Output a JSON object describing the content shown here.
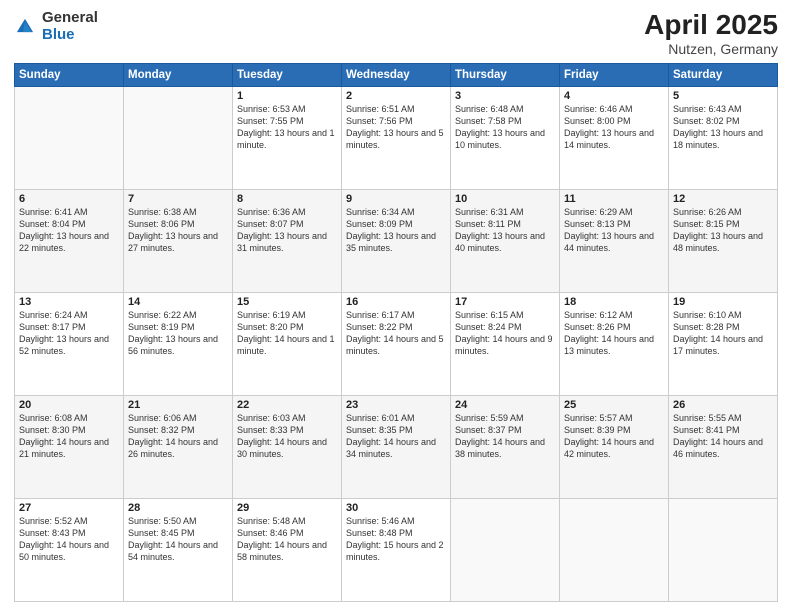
{
  "logo": {
    "general": "General",
    "blue": "Blue"
  },
  "header": {
    "month": "April 2025",
    "location": "Nutzen, Germany"
  },
  "weekdays": [
    "Sunday",
    "Monday",
    "Tuesday",
    "Wednesday",
    "Thursday",
    "Friday",
    "Saturday"
  ],
  "days": [
    {
      "date": "",
      "sunrise": "",
      "sunset": "",
      "daylight": ""
    },
    {
      "date": "",
      "sunrise": "",
      "sunset": "",
      "daylight": ""
    },
    {
      "date": "1",
      "sunrise": "Sunrise: 6:53 AM",
      "sunset": "Sunset: 7:55 PM",
      "daylight": "Daylight: 13 hours and 1 minute."
    },
    {
      "date": "2",
      "sunrise": "Sunrise: 6:51 AM",
      "sunset": "Sunset: 7:56 PM",
      "daylight": "Daylight: 13 hours and 5 minutes."
    },
    {
      "date": "3",
      "sunrise": "Sunrise: 6:48 AM",
      "sunset": "Sunset: 7:58 PM",
      "daylight": "Daylight: 13 hours and 10 minutes."
    },
    {
      "date": "4",
      "sunrise": "Sunrise: 6:46 AM",
      "sunset": "Sunset: 8:00 PM",
      "daylight": "Daylight: 13 hours and 14 minutes."
    },
    {
      "date": "5",
      "sunrise": "Sunrise: 6:43 AM",
      "sunset": "Sunset: 8:02 PM",
      "daylight": "Daylight: 13 hours and 18 minutes."
    },
    {
      "date": "6",
      "sunrise": "Sunrise: 6:41 AM",
      "sunset": "Sunset: 8:04 PM",
      "daylight": "Daylight: 13 hours and 22 minutes."
    },
    {
      "date": "7",
      "sunrise": "Sunrise: 6:38 AM",
      "sunset": "Sunset: 8:06 PM",
      "daylight": "Daylight: 13 hours and 27 minutes."
    },
    {
      "date": "8",
      "sunrise": "Sunrise: 6:36 AM",
      "sunset": "Sunset: 8:07 PM",
      "daylight": "Daylight: 13 hours and 31 minutes."
    },
    {
      "date": "9",
      "sunrise": "Sunrise: 6:34 AM",
      "sunset": "Sunset: 8:09 PM",
      "daylight": "Daylight: 13 hours and 35 minutes."
    },
    {
      "date": "10",
      "sunrise": "Sunrise: 6:31 AM",
      "sunset": "Sunset: 8:11 PM",
      "daylight": "Daylight: 13 hours and 40 minutes."
    },
    {
      "date": "11",
      "sunrise": "Sunrise: 6:29 AM",
      "sunset": "Sunset: 8:13 PM",
      "daylight": "Daylight: 13 hours and 44 minutes."
    },
    {
      "date": "12",
      "sunrise": "Sunrise: 6:26 AM",
      "sunset": "Sunset: 8:15 PM",
      "daylight": "Daylight: 13 hours and 48 minutes."
    },
    {
      "date": "13",
      "sunrise": "Sunrise: 6:24 AM",
      "sunset": "Sunset: 8:17 PM",
      "daylight": "Daylight: 13 hours and 52 minutes."
    },
    {
      "date": "14",
      "sunrise": "Sunrise: 6:22 AM",
      "sunset": "Sunset: 8:19 PM",
      "daylight": "Daylight: 13 hours and 56 minutes."
    },
    {
      "date": "15",
      "sunrise": "Sunrise: 6:19 AM",
      "sunset": "Sunset: 8:20 PM",
      "daylight": "Daylight: 14 hours and 1 minute."
    },
    {
      "date": "16",
      "sunrise": "Sunrise: 6:17 AM",
      "sunset": "Sunset: 8:22 PM",
      "daylight": "Daylight: 14 hours and 5 minutes."
    },
    {
      "date": "17",
      "sunrise": "Sunrise: 6:15 AM",
      "sunset": "Sunset: 8:24 PM",
      "daylight": "Daylight: 14 hours and 9 minutes."
    },
    {
      "date": "18",
      "sunrise": "Sunrise: 6:12 AM",
      "sunset": "Sunset: 8:26 PM",
      "daylight": "Daylight: 14 hours and 13 minutes."
    },
    {
      "date": "19",
      "sunrise": "Sunrise: 6:10 AM",
      "sunset": "Sunset: 8:28 PM",
      "daylight": "Daylight: 14 hours and 17 minutes."
    },
    {
      "date": "20",
      "sunrise": "Sunrise: 6:08 AM",
      "sunset": "Sunset: 8:30 PM",
      "daylight": "Daylight: 14 hours and 21 minutes."
    },
    {
      "date": "21",
      "sunrise": "Sunrise: 6:06 AM",
      "sunset": "Sunset: 8:32 PM",
      "daylight": "Daylight: 14 hours and 26 minutes."
    },
    {
      "date": "22",
      "sunrise": "Sunrise: 6:03 AM",
      "sunset": "Sunset: 8:33 PM",
      "daylight": "Daylight: 14 hours and 30 minutes."
    },
    {
      "date": "23",
      "sunrise": "Sunrise: 6:01 AM",
      "sunset": "Sunset: 8:35 PM",
      "daylight": "Daylight: 14 hours and 34 minutes."
    },
    {
      "date": "24",
      "sunrise": "Sunrise: 5:59 AM",
      "sunset": "Sunset: 8:37 PM",
      "daylight": "Daylight: 14 hours and 38 minutes."
    },
    {
      "date": "25",
      "sunrise": "Sunrise: 5:57 AM",
      "sunset": "Sunset: 8:39 PM",
      "daylight": "Daylight: 14 hours and 42 minutes."
    },
    {
      "date": "26",
      "sunrise": "Sunrise: 5:55 AM",
      "sunset": "Sunset: 8:41 PM",
      "daylight": "Daylight: 14 hours and 46 minutes."
    },
    {
      "date": "27",
      "sunrise": "Sunrise: 5:52 AM",
      "sunset": "Sunset: 8:43 PM",
      "daylight": "Daylight: 14 hours and 50 minutes."
    },
    {
      "date": "28",
      "sunrise": "Sunrise: 5:50 AM",
      "sunset": "Sunset: 8:45 PM",
      "daylight": "Daylight: 14 hours and 54 minutes."
    },
    {
      "date": "29",
      "sunrise": "Sunrise: 5:48 AM",
      "sunset": "Sunset: 8:46 PM",
      "daylight": "Daylight: 14 hours and 58 minutes."
    },
    {
      "date": "30",
      "sunrise": "Sunrise: 5:46 AM",
      "sunset": "Sunset: 8:48 PM",
      "daylight": "Daylight: 15 hours and 2 minutes."
    },
    {
      "date": "",
      "sunrise": "",
      "sunset": "",
      "daylight": ""
    },
    {
      "date": "",
      "sunrise": "",
      "sunset": "",
      "daylight": ""
    },
    {
      "date": "",
      "sunrise": "",
      "sunset": "",
      "daylight": ""
    }
  ]
}
